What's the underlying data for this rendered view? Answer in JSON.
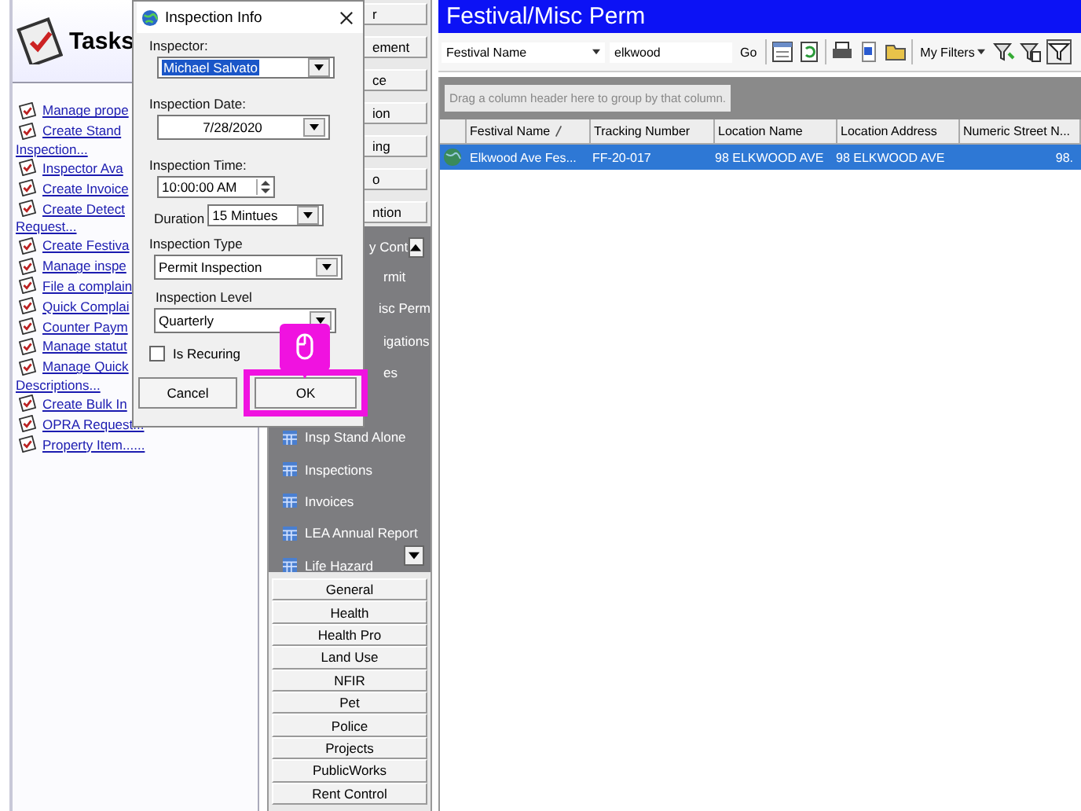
{
  "tasks": {
    "title": "Tasks",
    "items": [
      {
        "text": "Manage prope"
      },
      {
        "text": "Create Stand",
        "continuation": "Inspection..."
      },
      {
        "text": "Inspector Ava"
      },
      {
        "text": "Create Invoice"
      },
      {
        "text": "Create Detect",
        "continuation": "Request..."
      },
      {
        "text": "Create Festiva"
      },
      {
        "text": "Manage inspe"
      },
      {
        "text": "File a complain"
      },
      {
        "text": "Quick Complai"
      },
      {
        "text": "Counter Paym"
      },
      {
        "text": "Manage statut"
      },
      {
        "text": "Manage Quick",
        "continuation": "Descriptions..."
      },
      {
        "text": "Create Bulk In"
      },
      {
        "text": "OPRA Request..."
      },
      {
        "text": "Property Item......"
      }
    ]
  },
  "dialog": {
    "title": "Inspection Info",
    "inspector_label": "Inspector:",
    "inspector": "Michael Salvato",
    "date_label": "Inspection Date:",
    "date": "7/28/2020",
    "time_label": "Inspection Time:",
    "time": "10:00:00 AM",
    "duration_label": "Duration",
    "duration": "15 Mintues",
    "type_label": "Inspection Type",
    "type": "Permit Inspection",
    "level_label": "Inspection Level",
    "level": "Quarterly",
    "recurring": {
      "label": "Is Recuring",
      "checked": false
    },
    "cancel": "Cancel",
    "ok": "OK"
  },
  "nav": {
    "top_buttons": [
      "r",
      "ement",
      "ce",
      "ion",
      "ing",
      "o",
      "ntion"
    ],
    "list_header": "y Cont",
    "list_items": [
      {
        "text": "rmit",
        "icon": false
      },
      {
        "text": "isc Perm",
        "icon": false
      },
      {
        "text": "igations",
        "icon": false
      },
      {
        "text": "es",
        "icon": false
      },
      {
        "text": "Insp Stand Alone",
        "icon": true
      },
      {
        "text": "Inspections",
        "icon": true
      },
      {
        "text": "Invoices",
        "icon": true
      },
      {
        "text": "LEA Annual Report",
        "icon": true
      },
      {
        "text": "Life Hazard",
        "icon": true
      }
    ],
    "bottom_buttons": [
      "General",
      "Health",
      "Health Pro",
      "Land Use",
      "NFIR",
      "Pet",
      "Police",
      "Projects",
      "PublicWorks",
      "Rent Control"
    ]
  },
  "main": {
    "title": "Festival/Misc Perm",
    "search_field": "Festival Name",
    "search_value": "elkwood",
    "go": "Go",
    "filters": "My Filters",
    "group_hint": "Drag a column header here to group by that column.",
    "columns": [
      {
        "label": "Festival Name",
        "sorted": true
      },
      {
        "label": "Tracking Number",
        "sorted": false
      },
      {
        "label": "Location Name",
        "sorted": false
      },
      {
        "label": "Location Address",
        "sorted": false
      },
      {
        "label": "Numeric Street N...",
        "sorted": false
      }
    ],
    "rows": [
      {
        "selected": true,
        "cells": [
          "Elkwood Ave Fes...",
          "FF-20-017",
          "98 ELKWOOD AVE",
          "98 ELKWOOD AVE",
          "98."
        ]
      }
    ]
  }
}
